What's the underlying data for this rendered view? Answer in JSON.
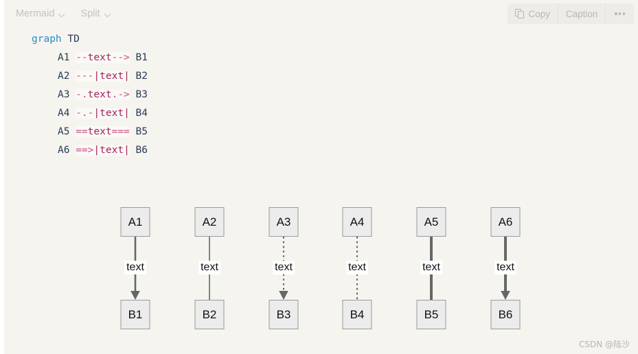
{
  "toolbar": {
    "left_menus": [
      {
        "label": "Mermaid",
        "icon": "chevron-down-icon"
      },
      {
        "label": "Split",
        "icon": "chevron-down-icon"
      }
    ],
    "copy_label": "Copy",
    "copy_icon": "copy-icon",
    "caption_label": "Caption",
    "more_icon": "ellipsis-icon"
  },
  "code": {
    "language": "mermaid",
    "lines": [
      {
        "indent": false,
        "tokens": [
          {
            "t": "kw",
            "v": "graph"
          },
          {
            "t": "plain",
            "v": " "
          },
          {
            "t": "dir",
            "v": "TD"
          }
        ]
      },
      {
        "indent": true,
        "tokens": [
          {
            "t": "nid",
            "v": "A1"
          },
          {
            "t": "plain",
            "v": " "
          },
          {
            "t": "op",
            "v": "--"
          },
          {
            "t": "lbl",
            "v": "text"
          },
          {
            "t": "op",
            "v": "--&gt;"
          },
          {
            "t": "plain",
            "v": " "
          },
          {
            "t": "nid",
            "v": "B1"
          }
        ]
      },
      {
        "indent": true,
        "tokens": [
          {
            "t": "nid",
            "v": "A2"
          },
          {
            "t": "plain",
            "v": " "
          },
          {
            "t": "op",
            "v": "---"
          },
          {
            "t": "pipe",
            "v": "|"
          },
          {
            "t": "lbl",
            "v": "text"
          },
          {
            "t": "pipe",
            "v": "|"
          },
          {
            "t": "plain",
            "v": " "
          },
          {
            "t": "nid",
            "v": "B2"
          }
        ]
      },
      {
        "indent": true,
        "tokens": [
          {
            "t": "nid",
            "v": "A3"
          },
          {
            "t": "plain",
            "v": " "
          },
          {
            "t": "op",
            "v": "-."
          },
          {
            "t": "lbl",
            "v": "text"
          },
          {
            "t": "op",
            "v": ".-&gt;"
          },
          {
            "t": "plain",
            "v": " "
          },
          {
            "t": "nid",
            "v": "B3"
          }
        ]
      },
      {
        "indent": true,
        "tokens": [
          {
            "t": "nid",
            "v": "A4"
          },
          {
            "t": "plain",
            "v": " "
          },
          {
            "t": "op",
            "v": "-.-"
          },
          {
            "t": "pipe",
            "v": "|"
          },
          {
            "t": "lbl",
            "v": "text"
          },
          {
            "t": "pipe",
            "v": "|"
          },
          {
            "t": "plain",
            "v": " "
          },
          {
            "t": "nid",
            "v": "B4"
          }
        ]
      },
      {
        "indent": true,
        "tokens": [
          {
            "t": "nid",
            "v": "A5"
          },
          {
            "t": "plain",
            "v": " "
          },
          {
            "t": "op",
            "v": "=="
          },
          {
            "t": "lbl",
            "v": "text"
          },
          {
            "t": "op",
            "v": "==="
          },
          {
            "t": "plain",
            "v": " "
          },
          {
            "t": "nid",
            "v": "B5"
          }
        ]
      },
      {
        "indent": true,
        "tokens": [
          {
            "t": "nid",
            "v": "A6"
          },
          {
            "t": "plain",
            "v": " "
          },
          {
            "t": "op",
            "v": "==&gt;"
          },
          {
            "t": "pipe",
            "v": "|"
          },
          {
            "t": "lbl",
            "v": "text"
          },
          {
            "t": "pipe",
            "v": "|"
          },
          {
            "t": "plain",
            "v": " "
          },
          {
            "t": "nid",
            "v": "B6"
          }
        ]
      }
    ]
  },
  "diagram": {
    "direction": "TD",
    "columns": [
      {
        "from": "A1",
        "to": "B1",
        "label": "text",
        "style": "solid",
        "width": 2.6,
        "arrow": true
      },
      {
        "from": "A2",
        "to": "B2",
        "label": "text",
        "style": "solid",
        "width": 1.6,
        "arrow": false
      },
      {
        "from": "A3",
        "to": "B3",
        "label": "text",
        "style": "dotted",
        "width": 2.2,
        "arrow": true
      },
      {
        "from": "A4",
        "to": "B4",
        "label": "text",
        "style": "dotted",
        "width": 2.2,
        "arrow": false
      },
      {
        "from": "A5",
        "to": "B5",
        "label": "text",
        "style": "solid",
        "width": 4.0,
        "arrow": false
      },
      {
        "from": "A6",
        "to": "B6",
        "label": "text",
        "style": "solid",
        "width": 4.0,
        "arrow": true
      }
    ],
    "column_centers": [
      197,
      305,
      413,
      520,
      628,
      736
    ],
    "node_fill": "#ececec",
    "node_stroke": "#999999",
    "edge_color": "#666666",
    "label_bg": "#ffffff"
  },
  "watermark": {
    "text": "CSDN @陆沙"
  },
  "colors": {
    "panel_bg": "#f5f4ef",
    "keyword": "#2e8bc8",
    "operator": "#c94f8a",
    "label": "#a4235c",
    "text": "#2b3a55",
    "toolbar_text": "#c4c2bd"
  }
}
